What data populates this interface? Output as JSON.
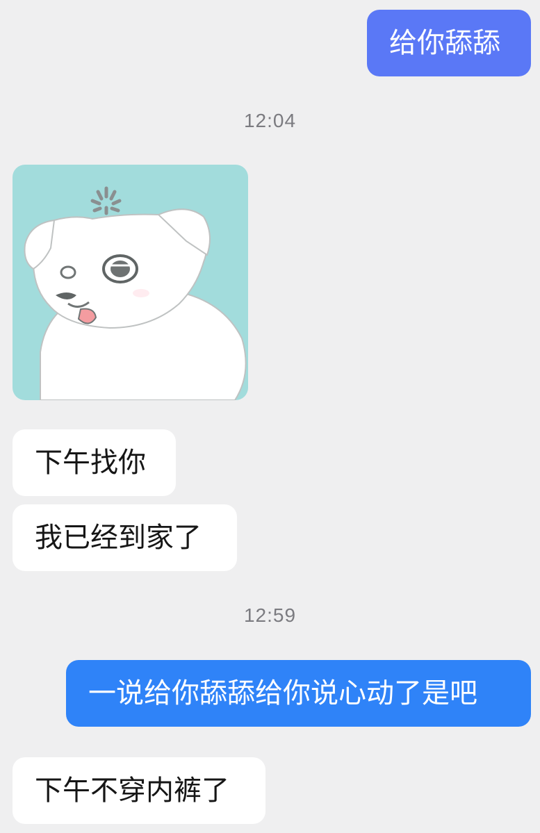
{
  "messages": [
    {
      "type": "text",
      "direction": "outgoing",
      "text": "给你舔舔",
      "color": "#5a78f6"
    },
    {
      "type": "timestamp",
      "text": "12:04"
    },
    {
      "type": "sticker",
      "direction": "incoming",
      "icon": "white-dog-sticker-icon",
      "background": "#a2dcdc"
    },
    {
      "type": "text",
      "direction": "incoming",
      "text": "下午找你"
    },
    {
      "type": "text",
      "direction": "incoming",
      "text": "我已经到家了"
    },
    {
      "type": "timestamp",
      "text": "12:59"
    },
    {
      "type": "text",
      "direction": "outgoing",
      "text": "一说给你舔舔给你说心动了是吧",
      "color": "#2f83f8"
    },
    {
      "type": "text",
      "direction": "incoming",
      "text": "下午不穿内裤了"
    }
  ],
  "colors": {
    "background": "#efeff0",
    "incoming_bubble": "#ffffff",
    "incoming_text": "#161616",
    "outgoing_text": "#ffffff",
    "timestamp_text": "#7b7b80"
  }
}
